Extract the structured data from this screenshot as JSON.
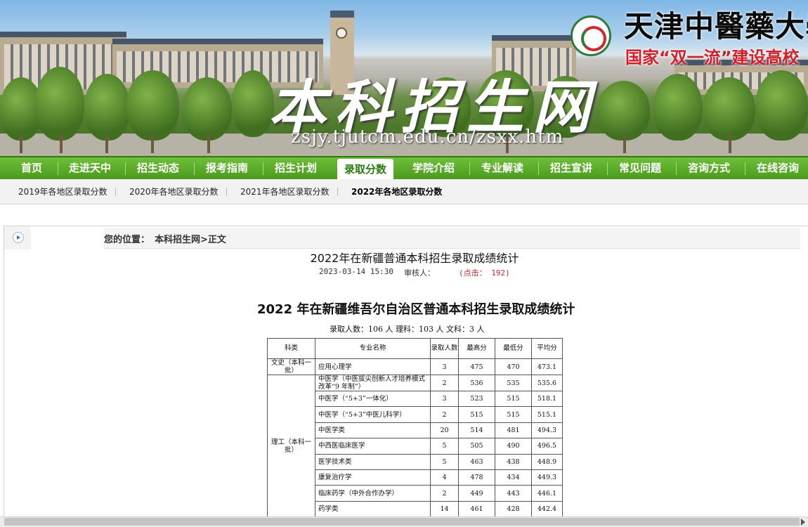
{
  "header": {
    "university_name": "天津中醫藥大學",
    "slogan": "国家“双一流”建设高校",
    "site_title": "本科招生网",
    "site_url": "zsjy.tjutcm.edu.cn/zsxx.htm"
  },
  "nav": {
    "items": [
      "首页",
      "走进天中",
      "招生动态",
      "报考指南",
      "招生计划",
      "录取分数",
      "学院介绍",
      "专业解读",
      "招生宣讲",
      "常见问题",
      "咨询方式",
      "在线咨询"
    ],
    "active_index": 5,
    "accent_color": "#4ea21f"
  },
  "subnav": {
    "items": [
      "2019年各地区录取分数",
      "2020年各地区录取分数",
      "2021年各地区录取分数",
      "2022年各地区录取分数"
    ],
    "active_index": 3
  },
  "breadcrumb": {
    "label": "您的位置：",
    "path": "本科招生网>正文"
  },
  "article": {
    "title": "2022年在新疆普通本科招生录取成绩统计",
    "date": "2023-03-14 15:30",
    "reviewer": "审核人：",
    "clicks": "(点击： 192)"
  },
  "document": {
    "title": "2022 年在新疆维吾尔自治区普通本科招生录取成绩统计",
    "summary": "录取人数：106 人    理科：103 人    文科：3 人"
  },
  "table": {
    "headers": [
      "科类",
      "专业名称",
      "录取人数",
      "最高分",
      "最低分",
      "平均分"
    ],
    "groups": [
      {
        "category": "文史（本科一批）",
        "rows": [
          [
            "应用心理学",
            "3",
            "475",
            "470",
            "473.1"
          ]
        ]
      },
      {
        "category": "理工（本科一批）",
        "rows": [
          [
            "中医学（中医拔尖创新人才培养模式改革“9 年制”）",
            "2",
            "536",
            "535",
            "535.6"
          ],
          [
            "中医学（“5+3”一体化）",
            "3",
            "523",
            "515",
            "518.1"
          ],
          [
            "中医学（“5+3”中医儿科学）",
            "2",
            "515",
            "515",
            "515.1"
          ],
          [
            "中医学类",
            "20",
            "514",
            "481",
            "494.3"
          ],
          [
            "中西医临床医学",
            "5",
            "505",
            "490",
            "496.5"
          ],
          [
            "医学技术类",
            "5",
            "463",
            "438",
            "448.9"
          ],
          [
            "康复治疗学",
            "4",
            "478",
            "434",
            "449.3"
          ],
          [
            "临床药学（中外合作办学）",
            "2",
            "449",
            "443",
            "446.1"
          ],
          [
            "药学类",
            "14",
            "461",
            "428",
            "442.4"
          ]
        ]
      }
    ]
  },
  "icons": {
    "side_arrow": "arrow-right-circle-icon",
    "logo": "university-seal-icon"
  }
}
